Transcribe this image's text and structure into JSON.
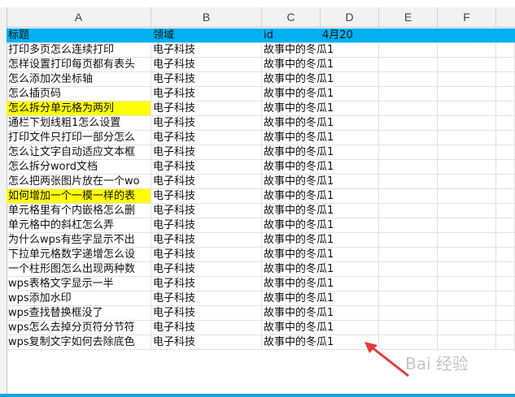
{
  "columns": [
    "A",
    "B",
    "C",
    "D",
    "E",
    "F"
  ],
  "header": {
    "title": "标题",
    "domain": "领域",
    "id": "id",
    "date": "4月20"
  },
  "rows": [
    {
      "title": "打印多页怎么连续打印",
      "domain": "电子科技",
      "id": "故事中的冬瓜1",
      "highlight": false
    },
    {
      "title": "怎样设置打印每页都有表头",
      "domain": "电子科技",
      "id": "故事中的冬瓜1",
      "highlight": false
    },
    {
      "title": "怎么添加次坐标轴",
      "domain": "电子科技",
      "id": "故事中的冬瓜1",
      "highlight": false
    },
    {
      "title": "怎么插页码",
      "domain": "电子科技",
      "id": "故事中的冬瓜1",
      "highlight": false
    },
    {
      "title": "怎么拆分单元格为两列",
      "domain": "电子科技",
      "id": "故事中的冬瓜1",
      "highlight": true
    },
    {
      "title": "通栏下划线粗1怎么设置",
      "domain": "电子科技",
      "id": "故事中的冬瓜1",
      "highlight": false
    },
    {
      "title": "打印文件只打印一部分怎么",
      "domain": "电子科技",
      "id": "故事中的冬瓜1",
      "highlight": false
    },
    {
      "title": "怎么让文字自动适应文本框",
      "domain": "电子科技",
      "id": "故事中的冬瓜1",
      "highlight": false
    },
    {
      "title": "怎么拆分word文档",
      "domain": "电子科技",
      "id": "故事中的冬瓜1",
      "highlight": false
    },
    {
      "title": "怎么把两张图片放在一个wo",
      "domain": "电子科技",
      "id": "故事中的冬瓜1",
      "highlight": false
    },
    {
      "title": "如何增加一个一模一样的表",
      "domain": "电子科技",
      "id": "故事中的冬瓜1",
      "highlight": true
    },
    {
      "title": "单元格里有个内嵌格怎么删",
      "domain": "电子科技",
      "id": "故事中的冬瓜1",
      "highlight": false
    },
    {
      "title": "单元格中的斜杠怎么弄",
      "domain": "电子科技",
      "id": "故事中的冬瓜1",
      "highlight": false
    },
    {
      "title": "为什么wps有些字显示不出",
      "domain": "电子科技",
      "id": "故事中的冬瓜1",
      "highlight": false
    },
    {
      "title": "下拉单元格数字递增怎么设",
      "domain": "电子科技",
      "id": "故事中的冬瓜1",
      "highlight": false
    },
    {
      "title": "一个柱形图怎么出现两种数",
      "domain": "电子科技",
      "id": "故事中的冬瓜1",
      "highlight": false
    },
    {
      "title": "wps表格文字显示一半",
      "domain": "电子科技",
      "id": "故事中的冬瓜1",
      "highlight": false
    },
    {
      "title": "wps添加水印",
      "domain": "电子科技",
      "id": "故事中的冬瓜1",
      "highlight": false
    },
    {
      "title": "wps查找替换框没了",
      "domain": "电子科技",
      "id": "故事中的冬瓜1",
      "highlight": false
    },
    {
      "title": "wps怎么去掉分页符分节符",
      "domain": "电子科技",
      "id": "故事中的冬瓜1",
      "highlight": false
    },
    {
      "title": "wps复制文字如何去除底色",
      "domain": "电子科技",
      "id": "故事中的冬瓜1",
      "highlight": false
    }
  ],
  "watermark": "Bai 经验",
  "colors": {
    "header_fill": "#00b0f0",
    "highlight_fill": "#ffff00",
    "arrow": "#e23b3b"
  },
  "icons": {
    "annotation": "red-arrow-icon"
  }
}
